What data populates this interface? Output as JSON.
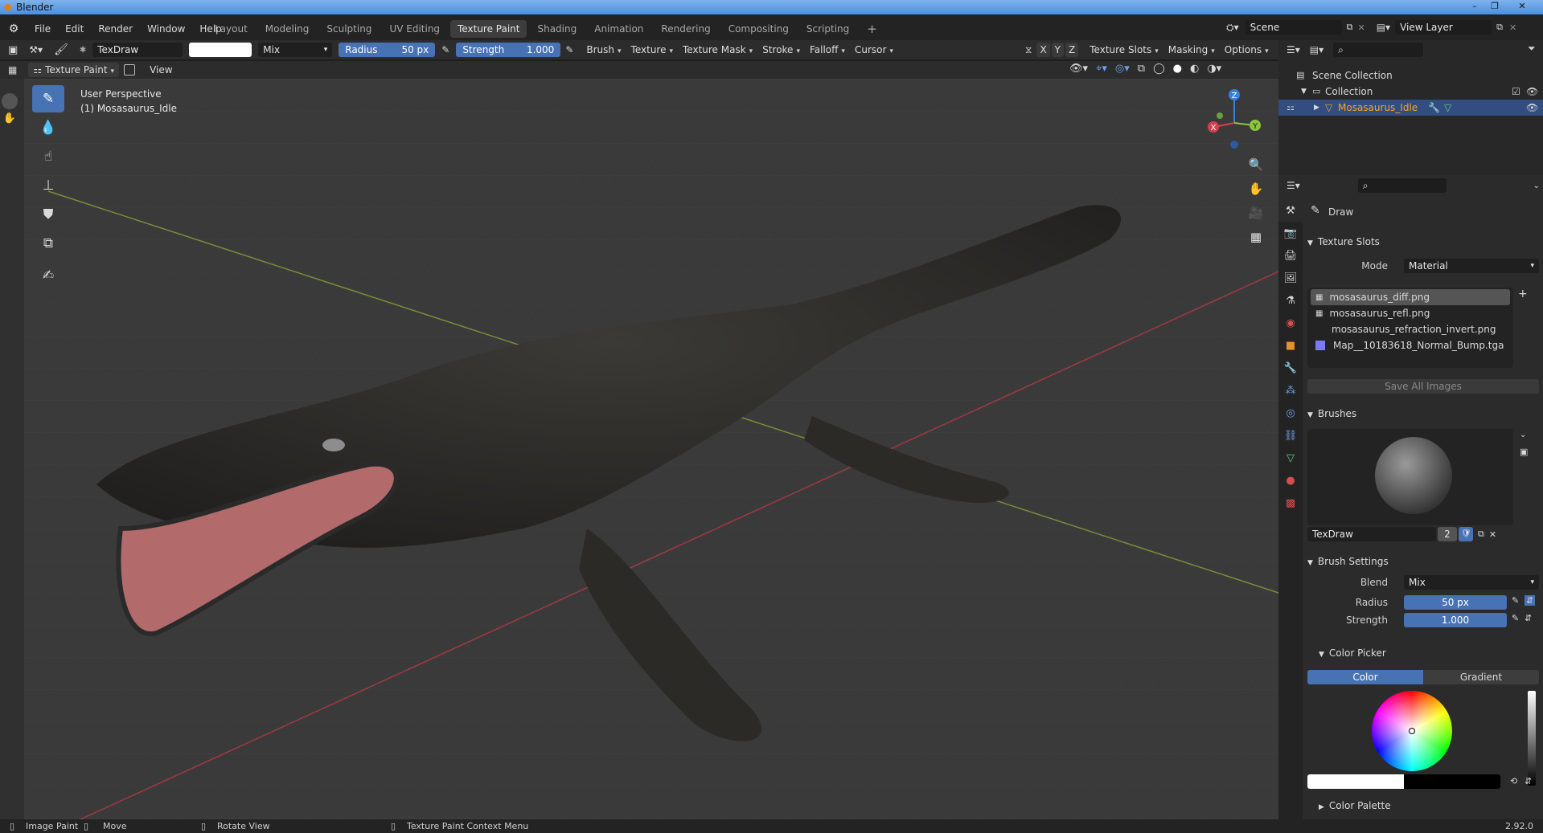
{
  "window": {
    "title": "Blender"
  },
  "menubar": {
    "menus": [
      "File",
      "Edit",
      "Render",
      "Window",
      "Help"
    ],
    "workspaces": [
      "Layout",
      "Modeling",
      "Sculpting",
      "UV Editing",
      "Texture Paint",
      "Shading",
      "Animation",
      "Rendering",
      "Compositing",
      "Scripting"
    ],
    "active_workspace": "Texture Paint",
    "add_workspace": "+",
    "scene": "Scene",
    "view_layer": "View Layer"
  },
  "tool_header": {
    "brush_name": "TexDraw",
    "blend": "Mix",
    "radius_label": "Radius",
    "radius_value": "50 px",
    "strength_label": "Strength",
    "strength_value": "1.000",
    "menus": [
      "Brush",
      "Texture",
      "Texture Mask",
      "Stroke",
      "Falloff",
      "Cursor"
    ],
    "axes": [
      "X",
      "Y",
      "Z"
    ],
    "right_menus": [
      "Texture Slots",
      "Masking",
      "Options"
    ]
  },
  "header2": {
    "mode": "Texture Paint",
    "view": "View"
  },
  "viewport": {
    "perspective": "User Perspective",
    "object": "(1) Mosasaurus_Idle",
    "gizmo_axes": [
      "X",
      "Y",
      "Z"
    ]
  },
  "outliner": {
    "scene_collection": "Scene Collection",
    "collection": "Collection",
    "object": "Mosasaurus_Idle"
  },
  "properties": {
    "tool_name": "Draw",
    "texture_slots_title": "Texture Slots",
    "mode_label": "Mode",
    "mode_value": "Material",
    "slots": [
      "mosasaurus_diff.png",
      "mosasaurus_refl.png",
      "mosasaurus_refraction_invert.png",
      "Map__10183618_Normal_Bump.tga"
    ],
    "save_all": "Save All Images",
    "brushes_title": "Brushes",
    "brush_name": "TexDraw",
    "brush_users": "2",
    "brush_settings_title": "Brush Settings",
    "blend_label": "Blend",
    "blend_value": "Mix",
    "radius_label": "Radius",
    "radius_value": "50 px",
    "strength_label": "Strength",
    "strength_value": "1.000",
    "color_picker_title": "Color Picker",
    "color_tab": "Color",
    "gradient_tab": "Gradient",
    "color_palette_title": "Color Palette"
  },
  "statusbar": {
    "items": [
      "Image Paint",
      "Move",
      "Rotate View",
      "Texture Paint Context Menu"
    ],
    "version": "2.92.0"
  },
  "colors": {
    "accent": "#4772b3",
    "selected_orange": "#f5a623",
    "x_axis": "#d4404e",
    "y_axis": "#8bc53f",
    "z_axis": "#3c7ee0"
  }
}
